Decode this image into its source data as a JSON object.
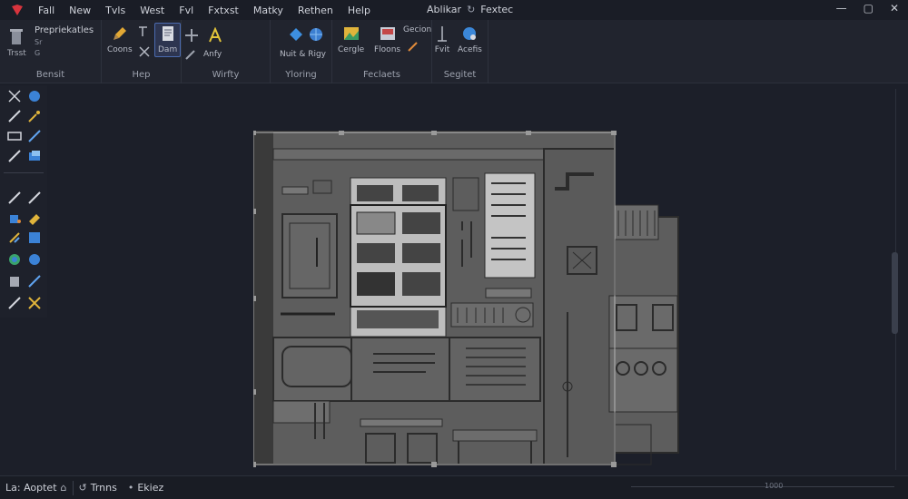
{
  "menubar": {
    "items": [
      "Fall",
      "New",
      "Tvls",
      "West",
      "Fvl",
      "Fxtxst",
      "Matky",
      "Rethen",
      "Help"
    ],
    "title": "Ablikar",
    "subtitle": "Fextec"
  },
  "ribbon": {
    "tool_top_label": "Prepriekatles",
    "tool_sub1": "Sr",
    "tool_sub2": "G",
    "tool_bottom": "Trsst",
    "groups": [
      {
        "label": "Bensit"
      },
      {
        "label": "Hep"
      },
      {
        "label": "Wirfty"
      },
      {
        "label": "Yloring"
      },
      {
        "label": "Feclaets"
      },
      {
        "label": "Segitet"
      }
    ],
    "buttons": {
      "coons": "Coons",
      "dam": "Dam",
      "anfy": "Anfy",
      "nuit": "Nuit & Rigy",
      "cergle": "Cergle",
      "floons": "Floons",
      "gecion": "Gecion",
      "fvit": "Fvit",
      "acefis": "Acefis"
    }
  },
  "status": {
    "left": "La: Aoptet",
    "mid": "Trnns",
    "right": "Ekiez",
    "scroll_label": "1000"
  },
  "colors": {
    "accent": "#4b6bb0",
    "plan_fill": "#5d5d5d",
    "plan_line": "#2b2b2b",
    "highlight": "#bdbdbd"
  }
}
